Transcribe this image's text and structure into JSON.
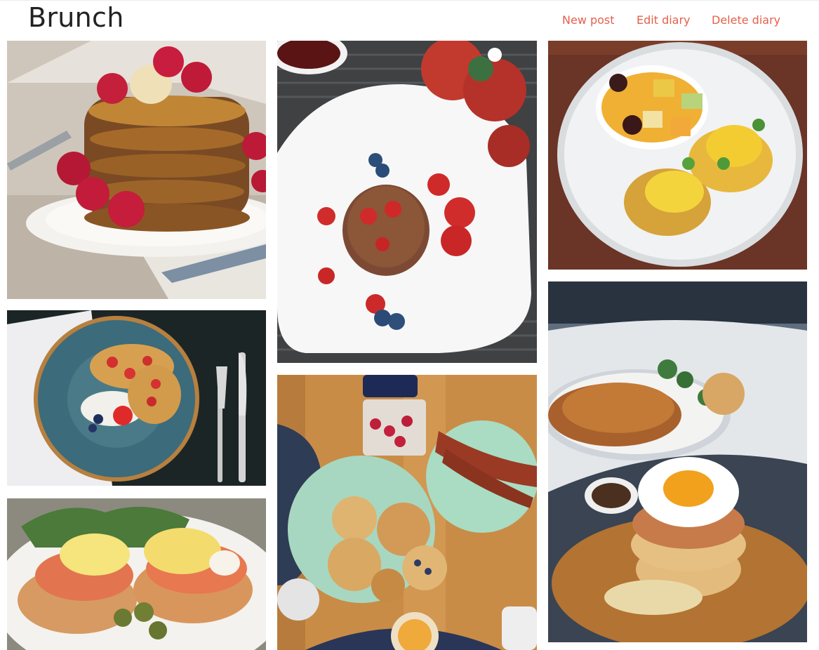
{
  "header": {
    "title": "Brunch",
    "actions": {
      "new_post": "New post",
      "edit_diary": "Edit diary",
      "delete_diary": "Delete diary"
    }
  },
  "theme": {
    "accent": "#e4604a",
    "title_color": "#222222"
  },
  "gallery": {
    "columns": 3,
    "photos": [
      {
        "id": "photo-raspberry-pancakes",
        "subject": "pancake stack with raspberries and butter"
      },
      {
        "id": "photo-strawberry-pancake-plate",
        "subject": "pancake on square plate with strawberries and blueberries"
      },
      {
        "id": "photo-fruit-eggs-benedict",
        "subject": "fruit bowl with eggs benedict"
      },
      {
        "id": "photo-blue-plate-pancakes",
        "subject": "pancakes on teal plate with fork and knife"
      },
      {
        "id": "photo-pancakes-bacon-table",
        "subject": "pancakes, bacon and berries on wooden table"
      },
      {
        "id": "photo-croissant-pancake-egg",
        "subject": "croissant plate and pancake stack with fried egg"
      },
      {
        "id": "photo-salmon-eggs-benedict",
        "subject": "salmon eggs benedict with capers"
      }
    ]
  }
}
